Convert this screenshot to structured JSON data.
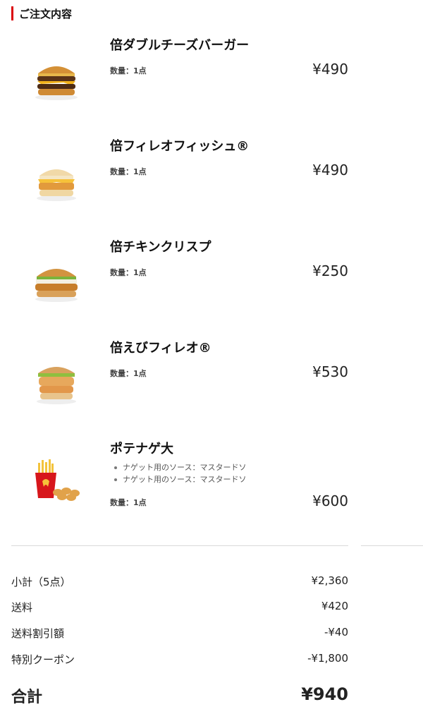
{
  "section": {
    "title": "ご注文内容"
  },
  "items": [
    {
      "name": "倍ダブルチーズバーガー",
      "qty": "数量：1点",
      "price": "¥490",
      "icon": "double-cheeseburger-icon"
    },
    {
      "name": "倍フィレオフィッシュ®",
      "qty": "数量：1点",
      "price": "¥490",
      "icon": "filet-o-fish-icon"
    },
    {
      "name": "倍チキンクリスプ",
      "qty": "数量：1点",
      "price": "¥250",
      "icon": "chicken-crisp-icon"
    },
    {
      "name": "倍えびフィレオ®",
      "qty": "数量：1点",
      "price": "¥530",
      "icon": "ebi-filet-o-icon"
    },
    {
      "name": "ポテナゲ大",
      "qty": "数量：1点",
      "price": "¥600",
      "icon": "fries-nuggets-icon",
      "options": [
        "ナゲット用のソース：マスタードソ",
        "ナゲット用のソース：マスタードソ"
      ]
    }
  ],
  "summary": {
    "subtotal_label": "小計（5点）",
    "subtotal_value": "¥2,360",
    "shipping_label": "送料",
    "shipping_value": "¥420",
    "shipping_discount_label": "送料割引額",
    "shipping_discount_value": "-¥40",
    "coupon_label": "特別クーポン",
    "coupon_value": "-¥1,800",
    "total_label": "合計",
    "total_value": "¥940"
  },
  "colors": {
    "accent": "#db0007",
    "text": "#222222",
    "divider": "#d9d9d9"
  }
}
